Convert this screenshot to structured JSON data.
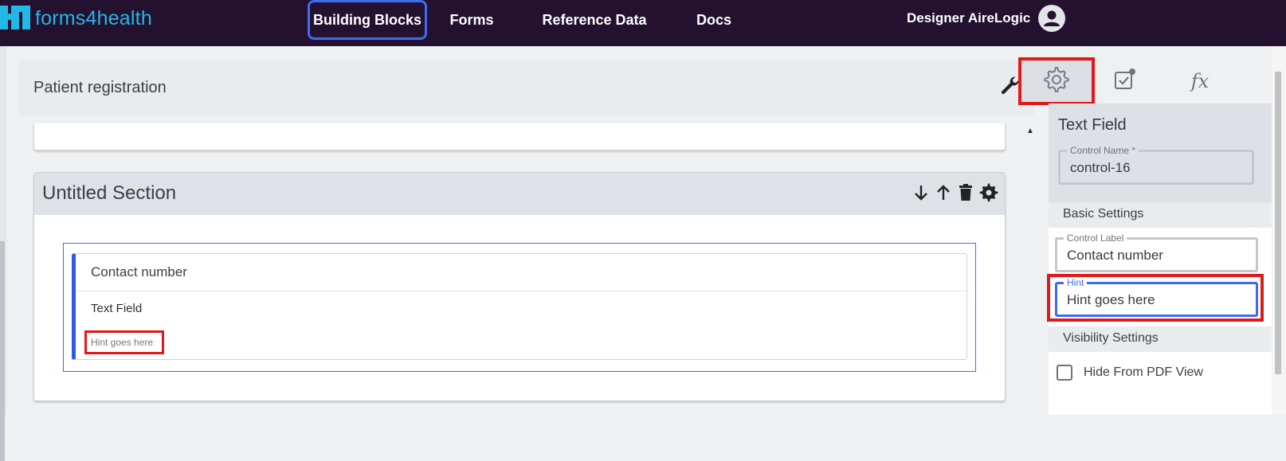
{
  "app": {
    "logo_text": "forms4health"
  },
  "nav": {
    "items": [
      {
        "label": "Building Blocks",
        "active": true
      },
      {
        "label": "Forms"
      },
      {
        "label": "Reference Data"
      },
      {
        "label": "Docs"
      }
    ]
  },
  "user": {
    "name": "Designer AireLogic",
    "icon": "user-avatar-icon"
  },
  "main": {
    "title": "Patient registration",
    "section": {
      "title": "Untitled Section",
      "tools": [
        "arrow-down-icon",
        "arrow-up-icon",
        "trash-icon",
        "gear-icon"
      ]
    },
    "control": {
      "label": "Contact number",
      "type": "Text Field",
      "hint": "Hint goes here"
    }
  },
  "panel": {
    "tabs": [
      "gear-icon",
      "checklist-icon",
      "fx-icon"
    ],
    "fx_label": "fx",
    "title": "Text Field",
    "control_name": {
      "legend": "Control Name *",
      "value": "control-16"
    },
    "basic_settings": "Basic Settings",
    "control_label": {
      "legend": "Control Label",
      "value": "Contact number"
    },
    "hint": {
      "legend": "Hint",
      "value": "Hint goes here"
    },
    "visibility_settings": "Visibility Settings",
    "hide_pdf": {
      "label": "Hide From PDF View",
      "checked": false
    }
  },
  "colors": {
    "topbar": "#24112f",
    "logo": "#22b8e6",
    "accent": "#3d6cf0",
    "highlight": "#e01a1a"
  }
}
